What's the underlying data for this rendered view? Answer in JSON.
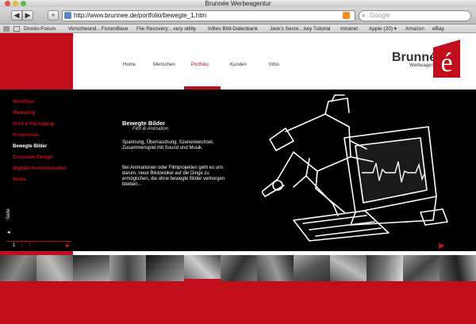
{
  "window": {
    "title": "Brunnée Werbeagentur"
  },
  "toolbar": {
    "url": "http://www.brunnee.de/portfolio/bewegte_1.htm",
    "search_placeholder": "Google",
    "back": "◀",
    "forward": "▶",
    "add": "+"
  },
  "bookmarks": [
    "Dronin-Forum",
    "Verschwund…ForumBase",
    "File Recovery…very utility",
    "InBev Bild-Datenbank",
    "Jack's Secre…key Tutorial",
    "Intranet",
    "Apple (20) ▾",
    "Amazon",
    "eBay"
  ],
  "site": {
    "nav": [
      "Home",
      "Menschen",
      "Portfolio",
      "Kunden",
      "Infos"
    ],
    "logo": {
      "word": "Brunnée",
      "sub": "Werbeagentur",
      "mark_letter": "é"
    },
    "menu": [
      "Workflow",
      "Marketing",
      "Print & Packaging",
      "Promotions",
      "Bewegte Bilder",
      "Corporate Design",
      "Digitale Kommunikation",
      "Media"
    ],
    "seite": "Seite",
    "pager": [
      "1",
      "2",
      "3"
    ],
    "heading": "Bewegte Bilder",
    "subheading": "Film & Animation",
    "para1": "Spannung, Überraschung, Szenenwechsel, Zusammenspiel mit Sound und Musik.",
    "para2": "Bei Animationen oder Filmprojekten geht es uns darum, neue Blickwinkel auf die Dinge zu ermöglichen, die ohne bewegte Bilder verborgen bleiben..."
  },
  "colors": {
    "brand_red": "#c20e1a",
    "band": "#000000"
  }
}
